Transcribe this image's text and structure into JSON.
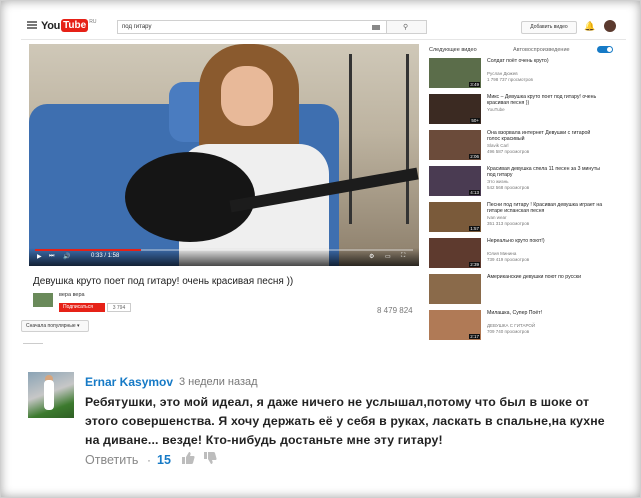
{
  "header": {
    "logo_you": "You",
    "logo_tube": "Tube",
    "logo_region": "RU",
    "search_value": "под гитару",
    "add_video_label": "Добавить видео"
  },
  "player": {
    "time": "0:33 / 1:58",
    "progress_fraction": 0.28
  },
  "video": {
    "title": "Девушка круто поет под гитару! очень красивая песня ))",
    "channel": "вера вера",
    "subscribe_label": "Подписаться",
    "subscriber_count": "3 794",
    "views": "8 479 824"
  },
  "comments_sort": "Сначала популярные",
  "sidebar": {
    "next_label": "Следующее видео",
    "autoplay_label": "Автовоспроизведение",
    "items": [
      {
        "title": "Солдат поёт очень круто)",
        "channel": "Руслан Дюжев",
        "views": "1 798 737 просмотров",
        "duration": "3:49",
        "color": "#5b6d4a"
      },
      {
        "title": "Микс – Девушка круто поет под гитару! очень красивая песня ))",
        "channel": "YouTube",
        "views": "",
        "duration": "50+",
        "color": "#3b2a22"
      },
      {
        "title": "Она взорвала интернет Девушки с гитарой голос красивый",
        "channel": "Slavik Carl",
        "views": "496 587 просмотров",
        "duration": "2:06",
        "color": "#6b4b3a"
      },
      {
        "title": "Красивая девушка спела 11 песен за 3 минуты под гитару",
        "channel": "Это жизнь",
        "views": "542 568 просмотров",
        "duration": "4:13",
        "color": "#4a3b52"
      },
      {
        "title": "Песни под гитару ! Красивая девушка играет на гитаре испанская песня",
        "channel": "Ivan wear",
        "views": "351 313 просмотров",
        "duration": "1:57",
        "color": "#7a5a3a"
      },
      {
        "title": "Нереально круто поют!)",
        "channel": "Юлия Минина",
        "views": "739 419 просмотров",
        "duration": "2:39",
        "color": "#5e3a2e"
      },
      {
        "title": "Американские девушки поют по русски",
        "channel": "",
        "views": "",
        "duration": "",
        "color": "#8a6a4a"
      },
      {
        "title": "Милашка, Супер Поёт!",
        "channel": "ДЕВУШКА С ГИТАРОЙ",
        "views": "709 740 просмотров",
        "duration": "2:17",
        "color": "#b07a56"
      }
    ]
  },
  "comment": {
    "author": "Ernar Kasymov",
    "time": "3 недели назад",
    "text": "Ребятушки, это мой идеал, я даже ничего не услышал,потому что был в шоке от этого совершенства. Я хочу держать её у себя в руках, ласкать в спальне,на кухне на диване... везде! Кто-нибудь достаньте мне эту гитару!",
    "reply_label": "Ответить",
    "separator": "·",
    "likes": "15"
  }
}
